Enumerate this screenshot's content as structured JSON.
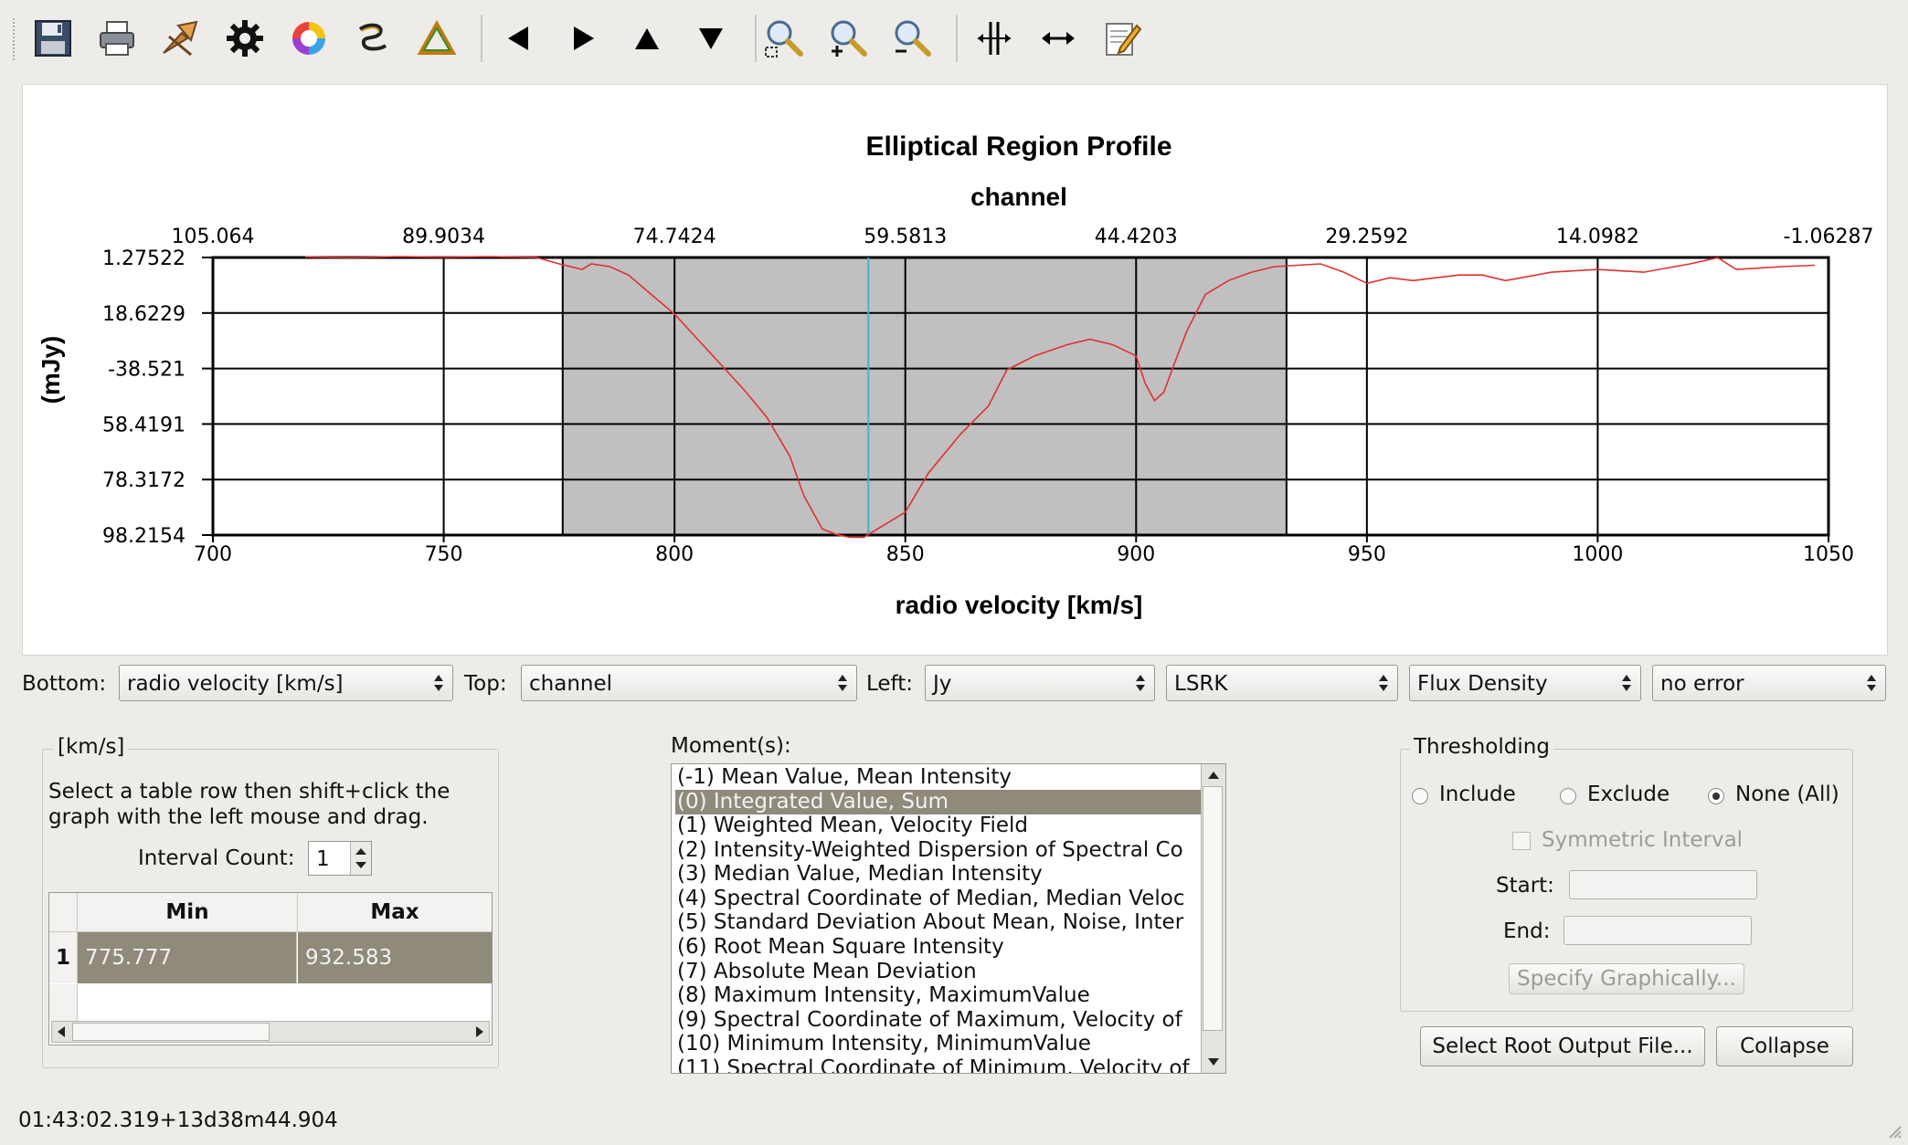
{
  "toolbar": {
    "buttons": [
      {
        "name": "save-icon"
      },
      {
        "name": "print-icon"
      },
      {
        "name": "export-icon"
      },
      {
        "name": "settings-gear-icon"
      },
      {
        "name": "color-wheel-icon"
      },
      {
        "name": "smooth-icon"
      },
      {
        "name": "triangle-icon"
      },
      {
        "name": "pan-left-icon"
      },
      {
        "name": "pan-right-icon"
      },
      {
        "name": "pan-up-icon"
      },
      {
        "name": "pan-down-icon"
      },
      {
        "name": "zoom-fit-icon"
      },
      {
        "name": "zoom-in-icon"
      },
      {
        "name": "zoom-out-icon"
      },
      {
        "name": "range-select-icon"
      },
      {
        "name": "horizontal-arrow-icon"
      },
      {
        "name": "annotate-icon"
      }
    ]
  },
  "plot": {
    "title": "Elliptical Region Profile",
    "top_axis_label": "channel",
    "bottom_axis_label": "radio velocity [km/s]",
    "left_axis_label": "(mJy)"
  },
  "chart_data": {
    "type": "line",
    "title": "Elliptical Region Profile",
    "xlabel": "radio velocity [km/s]",
    "x2label": "channel",
    "ylabel": "(mJy)",
    "xlim": [
      700,
      1050
    ],
    "x_ticks": [
      700,
      750,
      800,
      850,
      900,
      950,
      1000,
      1050
    ],
    "x2_tick_labels": [
      "105.064",
      "89.9034",
      "74.7424",
      "59.5813",
      "44.4203",
      "29.2592",
      "14.0982",
      "-1.06287"
    ],
    "y_tick_labels": [
      "1.27522",
      "18.6229",
      "-38.521",
      "58.4191",
      "78.3172",
      "98.2154"
    ],
    "ylim": [
      -98.2154,
      1.27522
    ],
    "grid": true,
    "selected_range": [
      775.777,
      932.583
    ],
    "marker_x": 842,
    "line_color": "#e03030",
    "shade_color": "#c0c0c0",
    "marker_color": "#3fb6c8",
    "series": [
      {
        "x": [
          720,
          730,
          740,
          750,
          760,
          770,
          775,
          780,
          782,
          786,
          790,
          795,
          800,
          805,
          810,
          815,
          820,
          825,
          828,
          832,
          835,
          838,
          841,
          845,
          850,
          855,
          858,
          862,
          868,
          872,
          878,
          885,
          890,
          895,
          900,
          902,
          904,
          906,
          908,
          911,
          915,
          920,
          925,
          930,
          935,
          940,
          945,
          950,
          955,
          960,
          965,
          970,
          975,
          980,
          990,
          1000,
          1010,
          1020,
          1026,
          1030,
          1040,
          1047
        ],
        "y": [
          1.5,
          1.2,
          1.6,
          1.4,
          1.6,
          1.3,
          -1,
          -3,
          -1,
          -2,
          -5,
          -12,
          -19,
          -28,
          -37,
          -46,
          -56,
          -70,
          -84,
          -96,
          -98,
          -99,
          -99,
          -95,
          -90,
          -76,
          -70,
          -62,
          -52,
          -39,
          -34,
          -30,
          -28,
          -30,
          -34,
          -44,
          -50,
          -47,
          -38,
          -25,
          -12,
          -7,
          -4,
          -2,
          -1.5,
          -1,
          -4,
          -8,
          -6,
          -7,
          -6,
          -5,
          -5,
          -7,
          -4,
          -3,
          -4,
          -1,
          1.2,
          -3,
          -2,
          -1.5
        ]
      }
    ]
  },
  "controls": {
    "bottom_label": "Bottom:",
    "bottom_value": "radio velocity [km/s]",
    "top_label": "Top:",
    "top_value": "channel",
    "left_label": "Left:",
    "left_value": "Jy",
    "frame_value": "LSRK",
    "quantity_value": "Flux Density",
    "error_value": "no error"
  },
  "range_panel": {
    "title": "[km/s]",
    "instructions_1": "Select a table row then shift+click the",
    "instructions_2": "graph with the left mouse and drag.",
    "interval_label": "Interval Count:",
    "interval_value": "1",
    "col_min": "Min",
    "col_max": "Max",
    "rows": [
      {
        "index": "1",
        "min": "775.777",
        "max": "932.583"
      }
    ]
  },
  "moments": {
    "label": "Moment(s):",
    "items": [
      "(-1) Mean Value, Mean Intensity",
      "(0) Integrated Value, Sum",
      "(1) Weighted Mean, Velocity Field",
      "(2) Intensity-Weighted Dispersion of Spectral Co",
      "(3) Median Value, Median Intensity",
      "(4) Spectral Coordinate of Median, Median Veloc",
      "(5) Standard Deviation About Mean, Noise, Inter",
      "(6) Root Mean Square Intensity",
      "(7) Absolute Mean Deviation",
      "(8) Maximum Intensity, MaximumValue",
      "(9) Spectral Coordinate of Maximum, Velocity of",
      "(10) Minimum Intensity, MinimumValue",
      "(11) Spectral Coordinate of Minimum, Velocity of"
    ],
    "selected_index": 1
  },
  "threshold": {
    "title": "Thresholding",
    "include": "Include",
    "exclude": "Exclude",
    "none": "None (All)",
    "symmetric": "Symmetric Interval",
    "start": "Start:",
    "end": "End:",
    "specify": "Specify Graphically..."
  },
  "actions": {
    "select_root": "Select Root Output File...",
    "collapse": "Collapse"
  },
  "status": {
    "coords": "01:43:02.319+13d38m44.904"
  }
}
